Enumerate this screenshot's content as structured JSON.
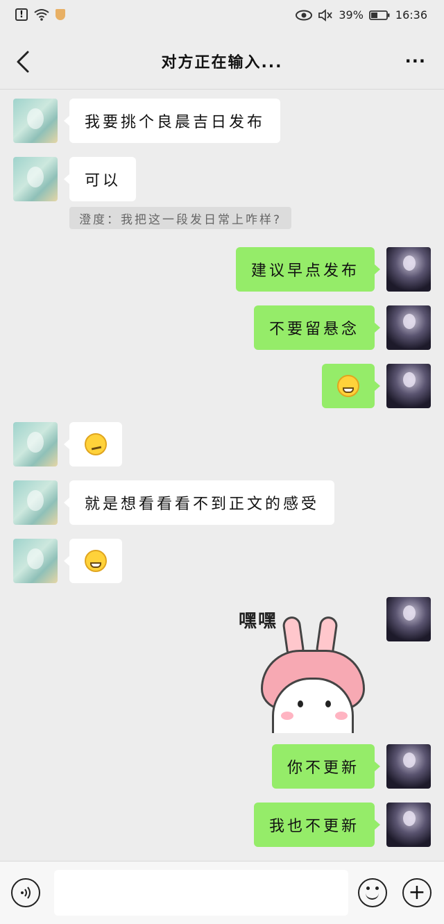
{
  "status_bar": {
    "battery_percent": "39%",
    "time": "16:36"
  },
  "header": {
    "title": "对方正在输入...",
    "more_label": "···"
  },
  "messages": [
    {
      "side": "left",
      "type": "text",
      "text": "我要挑个良晨吉日发布"
    },
    {
      "side": "left",
      "type": "text",
      "text": "可以"
    },
    {
      "side": "left",
      "type": "quote",
      "text": "澄度：我把这一段发日常上咋样?"
    },
    {
      "side": "right",
      "type": "text",
      "text": "建议早点发布"
    },
    {
      "side": "right",
      "type": "text",
      "text": "不要留悬念"
    },
    {
      "side": "right",
      "type": "emoji",
      "emoji": "grin-emoji"
    },
    {
      "side": "left",
      "type": "emoji",
      "emoji": "thinking-emoji"
    },
    {
      "side": "left",
      "type": "text",
      "text": "就是想看看看不到正文的感受"
    },
    {
      "side": "left",
      "type": "emoji",
      "emoji": "grin-emoji"
    },
    {
      "side": "right",
      "type": "sticker",
      "text": "嘿嘿"
    },
    {
      "side": "right",
      "type": "text",
      "text": "你不更新"
    },
    {
      "side": "right",
      "type": "text",
      "text": "我也不更新"
    }
  ],
  "bottom_bar": {
    "input_placeholder": ""
  },
  "colors": {
    "background": "#ededed",
    "own_bubble": "#95ec69",
    "other_bubble": "#ffffff"
  }
}
